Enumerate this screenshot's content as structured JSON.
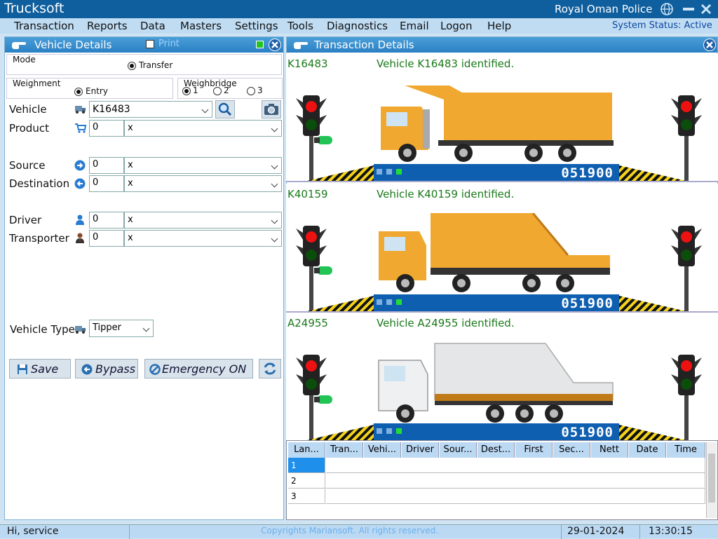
{
  "app": {
    "title": "Trucksoft",
    "org": "Royal Oman Police"
  },
  "menu": [
    "Transaction",
    "Reports",
    "Data",
    "Masters",
    "Settings",
    "Tools",
    "Diagnostics",
    "Email",
    "Logon",
    "Help"
  ],
  "system_status": "System Status: Active",
  "vehicle_panel": {
    "title": "Vehicle Details",
    "print_label": "Print",
    "mode_label": "Mode",
    "mode_value": "Transfer",
    "weighment_label": "Weighment",
    "weighment_value": "Entry",
    "weighbridge_label": "Weighbridge",
    "weighbridge_options": [
      "1",
      "2",
      "3"
    ],
    "vehicle_label": "Vehicle",
    "vehicle_value": "K16483",
    "product_label": "Product",
    "product_code": "0",
    "product_name": "x",
    "source_label": "Source",
    "source_code": "0",
    "source_name": "x",
    "destination_label": "Destination",
    "destination_code": "0",
    "destination_name": "x",
    "driver_label": "Driver",
    "driver_code": "0",
    "driver_name": "x",
    "transporter_label": "Transporter",
    "transporter_code": "0",
    "transporter_name": "x",
    "vehicle_type_label": "Vehicle Type",
    "vehicle_type_value": "Tipper",
    "save_label": "Save",
    "bypass_label": "Bypass",
    "emergency_label": "Emergency ON"
  },
  "transaction_panel": {
    "title": "Transaction Details"
  },
  "lanes": [
    {
      "id": "K16483",
      "message": "Vehicle K16483 identified.",
      "reading": "051900",
      "truck": "dump"
    },
    {
      "id": "K40159",
      "message": "Vehicle K40159 identified.",
      "reading": "051900",
      "truck": "compactor-orange"
    },
    {
      "id": "A24955",
      "message": "Vehicle A24955 identified.",
      "reading": "051900",
      "truck": "compactor-white"
    }
  ],
  "grid": {
    "headers": [
      "Lan...",
      "Tran...",
      "Vehi...",
      "Driver",
      "Sour...",
      "Dest...",
      "First",
      "Sec...",
      "Nett",
      "Date",
      "Time"
    ],
    "rows": [
      "1",
      "2",
      "3"
    ]
  },
  "status": {
    "user": "Hi, service",
    "copyright": "Copyrights Mariansoft. All rights reserved.",
    "date": "29-01-2024",
    "time": "13:30:15"
  },
  "colors": {
    "title_bar": "#0f5f9e",
    "accent": "#2b80c4",
    "status_green": "#1a7a1a"
  }
}
